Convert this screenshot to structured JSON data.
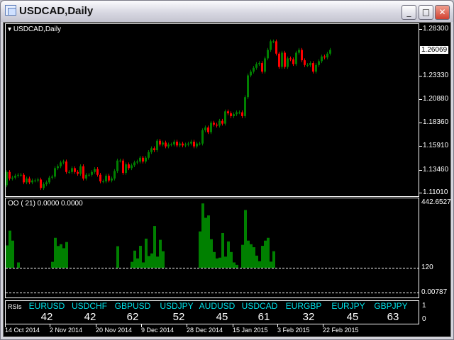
{
  "window": {
    "title": "USDCAD,Daily",
    "buttons": {
      "minimize": "_",
      "maximize": "□",
      "close": "✕"
    }
  },
  "main_pane": {
    "label": "USDCAD,Daily",
    "price_axis": [
      "1.28300",
      "1.23330",
      "1.20880",
      "1.18360",
      "1.15910",
      "1.13460",
      "1.11010"
    ],
    "current_price": "1.26069",
    "colors": {
      "bull": "#008000",
      "bear": "#ff0000"
    }
  },
  "indicator_pane": {
    "label": "OO ( 21) 0.0000 0.0000",
    "axis_max": "442.6527",
    "level": "120",
    "axis_min": "0.00787",
    "color": "#008000"
  },
  "rsi_pane": {
    "label": "RSIs",
    "axis_top": "1",
    "axis_bottom": "0",
    "items": [
      {
        "pair": "EURUSD",
        "value": "42"
      },
      {
        "pair": "USDCHF",
        "value": "42"
      },
      {
        "pair": "GBPUSD",
        "value": "62"
      },
      {
        "pair": "USDJPY",
        "value": "52"
      },
      {
        "pair": "AUDUSD",
        "value": "45"
      },
      {
        "pair": "USDCAD",
        "value": "61"
      },
      {
        "pair": "EURGBP",
        "value": "32"
      },
      {
        "pair": "EURJPY",
        "value": "45"
      },
      {
        "pair": "GBPJPY",
        "value": "63"
      }
    ]
  },
  "time_axis": [
    "14 Oct 2014",
    "2 Nov 2014",
    "20 Nov 2014",
    "9 Dec 2014",
    "28 Dec 2014",
    "15 Jan 2015",
    "3 Feb 2015",
    "22 Feb 2015"
  ],
  "chart_data": [
    {
      "type": "candlestick",
      "title": "USDCAD,Daily",
      "ylim": [
        1.1101,
        1.283
      ],
      "first_open": 1.118,
      "close": [
        1.132,
        1.125,
        1.126,
        1.128,
        1.129,
        1.129,
        1.121,
        1.125,
        1.121,
        1.123,
        1.123,
        1.124,
        1.115,
        1.119,
        1.121,
        1.126,
        1.127,
        1.136,
        1.138,
        1.142,
        1.143,
        1.132,
        1.132,
        1.136,
        1.132,
        1.13,
        1.138,
        1.125,
        1.129,
        1.129,
        1.132,
        1.135,
        1.129,
        1.122,
        1.122,
        1.128,
        1.123,
        1.125,
        1.133,
        1.144,
        1.144,
        1.131,
        1.14,
        1.136,
        1.139,
        1.142,
        1.143,
        1.147,
        1.143,
        1.147,
        1.153,
        1.157,
        1.155,
        1.165,
        1.161,
        1.163,
        1.159,
        1.161,
        1.161,
        1.164,
        1.16,
        1.162,
        1.16,
        1.161,
        1.162,
        1.164,
        1.159,
        1.162,
        1.162,
        1.176,
        1.179,
        1.174,
        1.184,
        1.182,
        1.181,
        1.186,
        1.183,
        1.196,
        1.194,
        1.191,
        1.193,
        1.195,
        1.195,
        1.191,
        1.211,
        1.234,
        1.238,
        1.242,
        1.246,
        1.247,
        1.238,
        1.252,
        1.261,
        1.27,
        1.27,
        1.257,
        1.243,
        1.258,
        1.243,
        1.252,
        1.251,
        1.246,
        1.258,
        1.261,
        1.25,
        1.245,
        1.245,
        1.247,
        1.238,
        1.245,
        1.249,
        1.254,
        1.253,
        1.257,
        1.261
      ]
    },
    {
      "type": "bar",
      "title": "OO ( 21)",
      "ylim": [
        0.00787,
        442.6527
      ],
      "baseline": 120,
      "values": [
        232,
        306,
        256,
        0,
        147,
        0,
        0,
        0,
        0,
        0,
        0,
        0,
        0,
        0,
        0,
        0,
        150,
        270,
        229,
        238,
        218,
        249,
        0,
        0,
        0,
        0,
        0,
        0,
        0,
        0,
        0,
        0,
        0,
        0,
        0,
        0,
        0,
        0,
        0,
        228,
        0,
        0,
        0,
        0,
        150,
        206,
        167,
        230,
        147,
        266,
        179,
        192,
        329,
        176,
        260,
        203,
        0,
        0,
        0,
        0,
        0,
        0,
        0,
        0,
        0,
        0,
        0,
        0,
        302,
        442,
        370,
        382,
        263,
        199,
        167,
        171,
        294,
        176,
        252,
        199,
        147,
        135,
        0,
        235,
        409,
        256,
        238,
        223,
        181,
        153,
        230,
        256,
        270,
        151,
        203
      ]
    }
  ]
}
